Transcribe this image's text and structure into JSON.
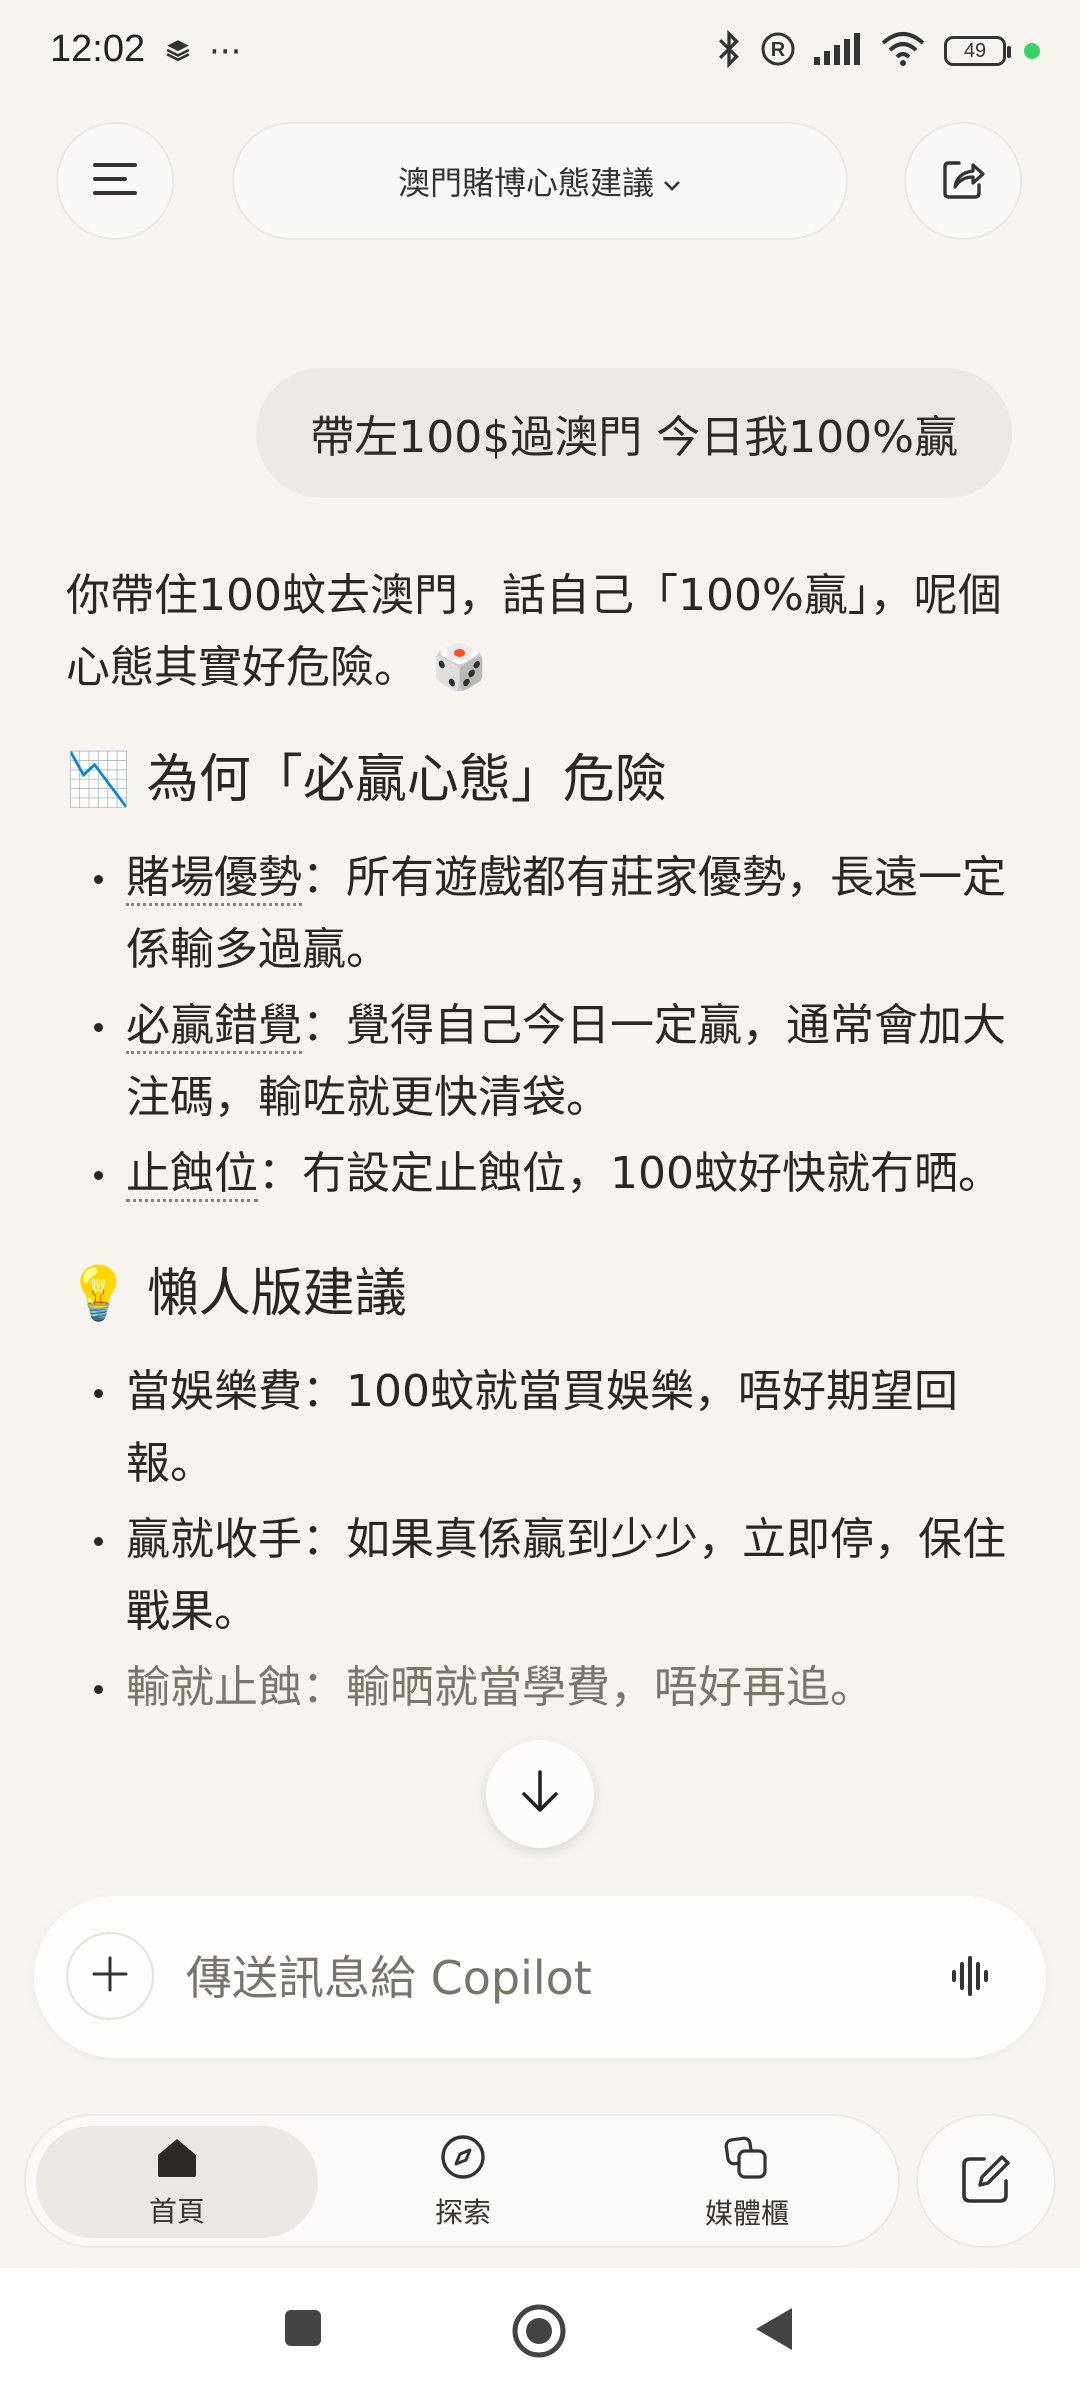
{
  "status_bar": {
    "time": "12:02",
    "more": "···",
    "battery": "49",
    "colors": {
      "dot": "#3ad06a"
    }
  },
  "top_bar": {
    "title": "澳門賭博心態建議",
    "menu_icon": "hamburger-icon",
    "share_icon": "share-icon"
  },
  "conversation": {
    "user_message": "帶左100$過澳門 今日我100%贏",
    "intro": "你帶住100蚊去澳門，話自己「100%贏」，呢個心態其實好危險。",
    "intro_emoji": "🎲",
    "section1": {
      "emoji": "📉",
      "title": "為何「必贏心態」危險",
      "items": [
        {
          "term": "賭場優勢",
          "text": "：所有遊戲都有莊家優勢，長遠一定係輸多過贏。"
        },
        {
          "term": "必贏錯覺",
          "text": "：覺得自己今日一定贏，通常會加大注碼，輸咗就更快清袋。"
        },
        {
          "term": "止蝕位",
          "text": "：冇設定止蝕位，100蚊好快就冇晒。"
        }
      ]
    },
    "section2": {
      "emoji": "💡",
      "title": "懶人版建議",
      "items": [
        {
          "term": "當娛樂費",
          "text": "：100蚊就當買娛樂，唔好期望回報。"
        },
        {
          "term": "贏就收手",
          "text": "：如果真係贏到少少，立即停，保住戰果。"
        },
        {
          "term": "輸就止蝕",
          "text": "：輸晒就當學費，唔好再追。"
        }
      ]
    }
  },
  "composer": {
    "placeholder": "傳送訊息給 Copilot"
  },
  "bottom_nav": {
    "items": [
      {
        "label": "首頁",
        "icon": "home-icon",
        "active": true
      },
      {
        "label": "探索",
        "icon": "compass-icon",
        "active": false
      },
      {
        "label": "媒體櫃",
        "icon": "library-icon",
        "active": false
      }
    ]
  },
  "colors": {
    "background": "#f7f3ef",
    "bubble": "#ede8e3",
    "text": "#2b2622"
  }
}
